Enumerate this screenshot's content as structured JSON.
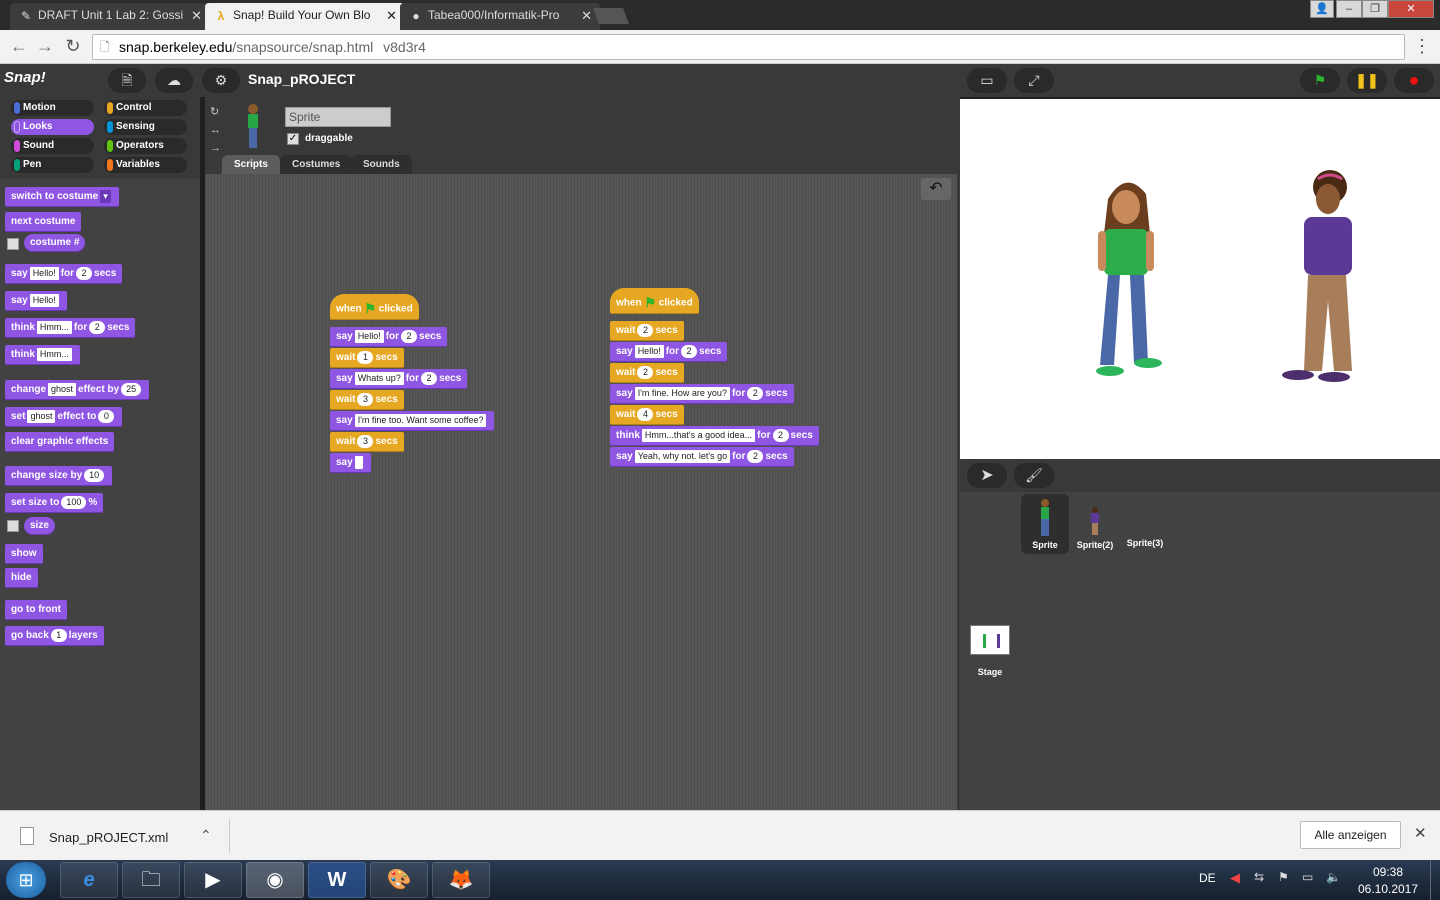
{
  "browser": {
    "tabs": [
      {
        "title": "DRAFT Unit 1 Lab 2: Gossi",
        "icon": "pencil-icon"
      },
      {
        "title": "Snap! Build Your Own Blo",
        "icon": "snap-lambda-icon",
        "active": true
      },
      {
        "title": "Tabea000/Informatik-Pro",
        "icon": "github-icon"
      }
    ],
    "url_host": "snap.berkeley.edu",
    "url_path": "/snapsource/snap.html",
    "url_extra": "v8d3r4"
  },
  "snap": {
    "logo": "Snap!",
    "project_name": "Snap_pROJECT",
    "categories": [
      {
        "label": "Motion",
        "color": "#4a6cd4"
      },
      {
        "label": "Control",
        "color": "#e6a822"
      },
      {
        "label": "Looks",
        "color": "#8f56e3",
        "selected": true
      },
      {
        "label": "Sensing",
        "color": "#0494dc"
      },
      {
        "label": "Sound",
        "color": "#cf4ad9"
      },
      {
        "label": "Operators",
        "color": "#62c213"
      },
      {
        "label": "Pen",
        "color": "#00a178"
      },
      {
        "label": "Variables",
        "color": "#f3761d"
      }
    ],
    "palette": {
      "switch_to_costume": "switch to costume",
      "next_costume": "next costume",
      "costume_num": "costume #",
      "say": "say",
      "for": "for",
      "secs": "secs",
      "think": "think",
      "hello": "Hello!",
      "hmm": "Hmm...",
      "two": "2",
      "change": "change",
      "ghost": "ghost",
      "effect_by": "effect by",
      "twentyfive": "25",
      "set": "set",
      "effect_to": "effect to",
      "zero": "0",
      "clear_graphic_effects": "clear graphic effects",
      "change_size_by": "change size by",
      "ten": "10",
      "set_size_to": "set size to",
      "hundred": "100",
      "percent": "%",
      "size": "size",
      "show": "show",
      "hide": "hide",
      "go_to_front": "go to front",
      "go_back": "go back",
      "one": "1",
      "layers": "layers"
    },
    "sprite": {
      "name": "Sprite",
      "draggable_label": "draggable",
      "tabs": [
        "Scripts",
        "Costumes",
        "Sounds"
      ]
    },
    "script1": {
      "when": "when",
      "clicked": "clicked",
      "say1": "Hello!",
      "say1_secs": "2",
      "wait1": "1",
      "say2": "Whats up?",
      "say2_secs": "2",
      "wait2": "3",
      "say3": "I'm fine too. Want some coffee?",
      "wait3": "3",
      "say4": ""
    },
    "script2": {
      "when": "when",
      "clicked": "clicked",
      "wait1": "2",
      "say1": "Hello!",
      "say1_secs": "2",
      "wait2": "2",
      "say2": "I'm fine. How are you?",
      "say2_secs": "2",
      "wait3": "4",
      "think1": "Hmm...that's a good idea...",
      "think1_secs": "2",
      "say3": "Yeah, why not. let's go",
      "say3_secs": "2"
    },
    "words": {
      "say": "say",
      "for": "for",
      "secs": "secs",
      "wait": "wait",
      "think": "think"
    },
    "corral": {
      "sprites": [
        "Sprite",
        "Sprite(2)",
        "Sprite(3)"
      ],
      "stage_label": "Stage"
    }
  },
  "downloads": {
    "file": "Snap_pROJECT.xml",
    "show_all": "Alle anzeigen"
  },
  "taskbar": {
    "lang": "DE",
    "time": "09:38",
    "date": "06.10.2017"
  }
}
